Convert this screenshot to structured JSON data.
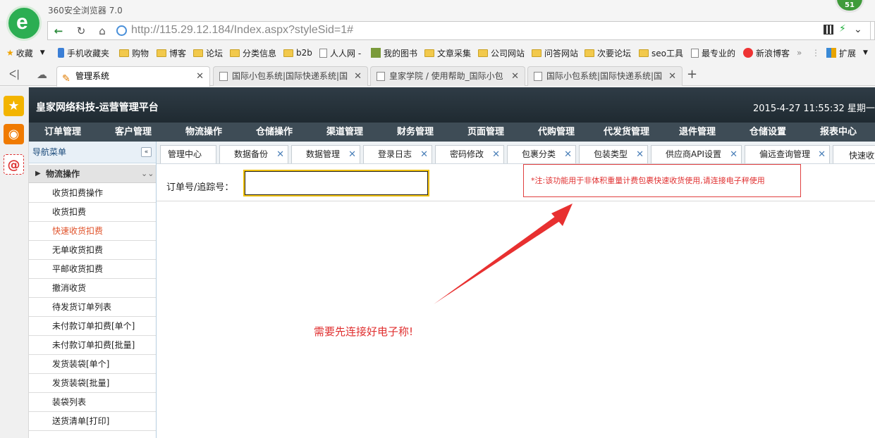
{
  "browser": {
    "title": "360安全浏览器 7.0",
    "badge": "51",
    "url_host": "http://115.29.12.184",
    "url_path": "/Index.aspx?styleSid=1#",
    "bookmarks": [
      "收藏",
      "手机收藏夹",
      "购物",
      "博客",
      "论坛",
      "分类信息",
      "b2b",
      "人人网 -",
      "我的图书",
      "文章采集",
      "公司网站",
      "问答网站",
      "次要论坛",
      "seo工具",
      "最专业的",
      "新浪博客",
      "扩展"
    ],
    "tabs": [
      {
        "label": "管理系统",
        "active": true
      },
      {
        "label": "国际小包系统|国际快递系统|国",
        "active": false
      },
      {
        "label": "皇家学院 / 使用帮助_国际小包",
        "active": false
      },
      {
        "label": "国际小包系统|国际快递系统|国",
        "active": false
      }
    ],
    "new_tab": "+"
  },
  "app": {
    "brand": "皇家网络科技-运营管理平台",
    "datetime": "2015-4-27 11:55:32  星期一",
    "main_nav": [
      "订单管理",
      "客户管理",
      "物流操作",
      "仓储操作",
      "渠道管理",
      "财务管理",
      "页面管理",
      "代购管理",
      "代发货管理",
      "退件管理",
      "仓储设置",
      "报表中心"
    ],
    "sidebar": {
      "title": "导航菜单",
      "collapse": "«",
      "group": "物流操作",
      "items": [
        "收货扣费操作",
        "收货扣费",
        "快速收货扣费",
        "无单收货扣费",
        "平邮收货扣费",
        "撤消收货",
        "待发货订单列表",
        "未付款订单扣费[单个]",
        "未付款订单扣费[批量]",
        "发货装袋[单个]",
        "发货装袋[批量]",
        "装袋列表",
        "送货清单[打印]"
      ],
      "selected_index": 2
    },
    "content_tabs": [
      "管理中心",
      "数据备份",
      "数据管理",
      "登录日志",
      "密码修改",
      "包裹分类",
      "包装类型",
      "供应商API设置",
      "偏远查询管理",
      "快速收货"
    ],
    "form": {
      "order_label": "订单号/追踪号：",
      "order_value": ""
    },
    "note": "*注:该功能用于非体积重量计费包裹快速收货使用,请连接电子秤使用",
    "annotation": "需要先连接好电子称!"
  },
  "colors": {
    "header": "#2b3740",
    "nav": "#3e4c56",
    "accent_red": "#e03030",
    "selected_item": "#e0522a"
  }
}
